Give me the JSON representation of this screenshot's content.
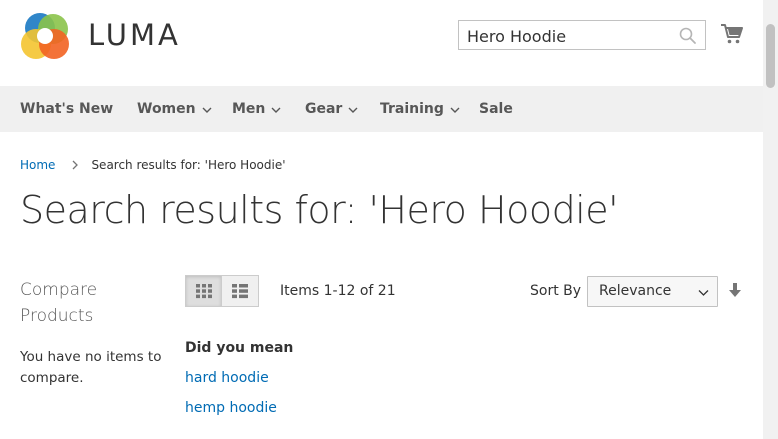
{
  "header": {
    "logo_text": "LUMA",
    "search": {
      "value": "Hero Hoodie",
      "placeholder": "Search entire store here..."
    },
    "icons": {
      "search": "search-icon",
      "cart": "cart-icon",
      "logo": "luma-logo-icon"
    }
  },
  "nav": {
    "items": [
      {
        "label": "What's New",
        "has_dropdown": false
      },
      {
        "label": "Women",
        "has_dropdown": true
      },
      {
        "label": "Men",
        "has_dropdown": true
      },
      {
        "label": "Gear",
        "has_dropdown": true
      },
      {
        "label": "Training",
        "has_dropdown": true
      },
      {
        "label": "Sale",
        "has_dropdown": false
      }
    ]
  },
  "breadcrumb": {
    "home": "Home",
    "current": "Search results for: 'Hero Hoodie'"
  },
  "page_title": "Search results for: 'Hero Hoodie'",
  "sidebar": {
    "compare_title": "Compare Products",
    "compare_empty": "You have no items to compare."
  },
  "toolbar": {
    "view_modes": [
      "grid",
      "list"
    ],
    "active_mode": "grid",
    "items_count": "Items 1-12 of 21",
    "sort_label": "Sort By",
    "sort_value": "Relevance"
  },
  "did_you_mean": {
    "title": "Did you mean",
    "suggestions": [
      "hard hoodie",
      "hemp hoodie"
    ]
  },
  "colors": {
    "link": "#006bb4",
    "nav_bg": "#f0f0f0",
    "text": "#333333",
    "logo_orange": "#f26322",
    "logo_blue": "#1979c3",
    "logo_green": "#8bc34a",
    "logo_yellow": "#f4c430"
  }
}
